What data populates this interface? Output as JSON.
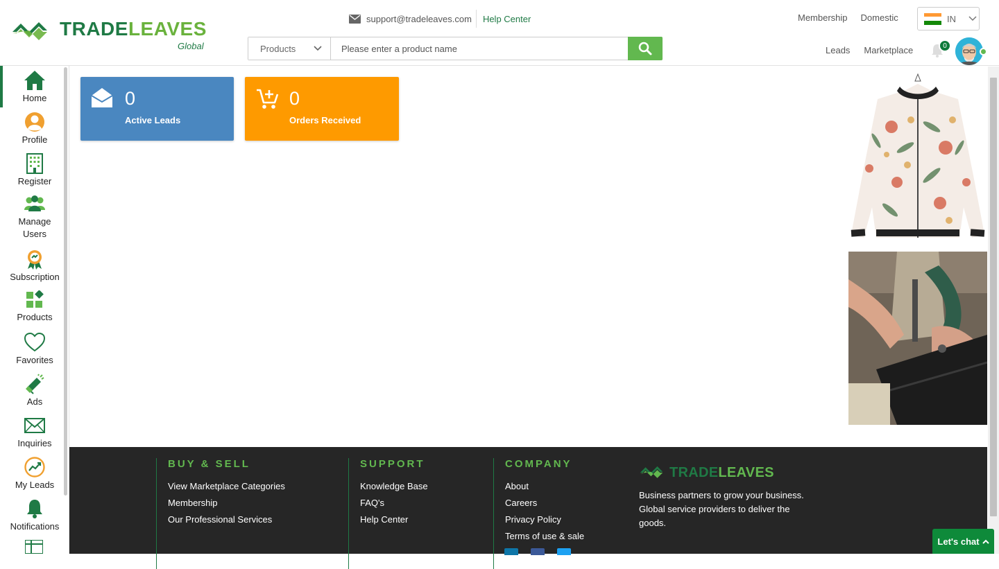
{
  "brand": {
    "name_part1": "TRADE",
    "name_part2": "LEAVES",
    "tagline": "Global"
  },
  "contact": {
    "email": "support@tradeleaves.com",
    "help_center": "Help Center"
  },
  "search": {
    "category": "Products",
    "placeholder": "Please enter a product name"
  },
  "top_links": {
    "membership": "Membership",
    "domestic": "Domestic"
  },
  "language": {
    "code": "IN"
  },
  "nav_links": {
    "leads": "Leads",
    "marketplace": "Marketplace"
  },
  "notifications": {
    "count": "0"
  },
  "sidebar": {
    "items": [
      {
        "label": "Home",
        "icon": "home-icon"
      },
      {
        "label": "Profile",
        "icon": "profile-icon"
      },
      {
        "label": "Register",
        "icon": "building-icon"
      },
      {
        "label": "Manage Users",
        "icon": "users-icon"
      },
      {
        "label": "Subscription",
        "icon": "badge-icon"
      },
      {
        "label": "Products",
        "icon": "products-icon"
      },
      {
        "label": "Favorites",
        "icon": "heart-icon"
      },
      {
        "label": "Ads",
        "icon": "megaphone-icon"
      },
      {
        "label": "Inquiries",
        "icon": "envelope-icon"
      },
      {
        "label": "My Leads",
        "icon": "leads-chart-icon"
      },
      {
        "label": "Notifications",
        "icon": "bell-icon"
      }
    ]
  },
  "cards": {
    "active_leads": {
      "count": "0",
      "label": "Active Leads",
      "color": "#4a87c0"
    },
    "orders_received": {
      "count": "0",
      "label": "Orders Received",
      "color": "#fe9a00"
    }
  },
  "footer": {
    "buy_sell": {
      "heading": "BUY & SELL",
      "links": [
        "View Marketplace Categories",
        "Membership",
        "Our Professional Services"
      ]
    },
    "support": {
      "heading": "SUPPORT",
      "links": [
        "Knowledge Base",
        "FAQ's",
        "Help Center"
      ]
    },
    "company": {
      "heading": "COMPANY",
      "links": [
        "About",
        "Careers",
        "Privacy Policy",
        "Terms of use & sale"
      ]
    },
    "brand": {
      "name_part1": "TRADE",
      "name_part2": "LEAVES",
      "description": "Business partners to grow your business. Global service providers to deliver the goods."
    }
  },
  "chat": {
    "label": "Let's chat"
  },
  "colors": {
    "brand_dark": "#1f7a45",
    "brand_light": "#62b84f",
    "footer_bg": "#262626"
  }
}
